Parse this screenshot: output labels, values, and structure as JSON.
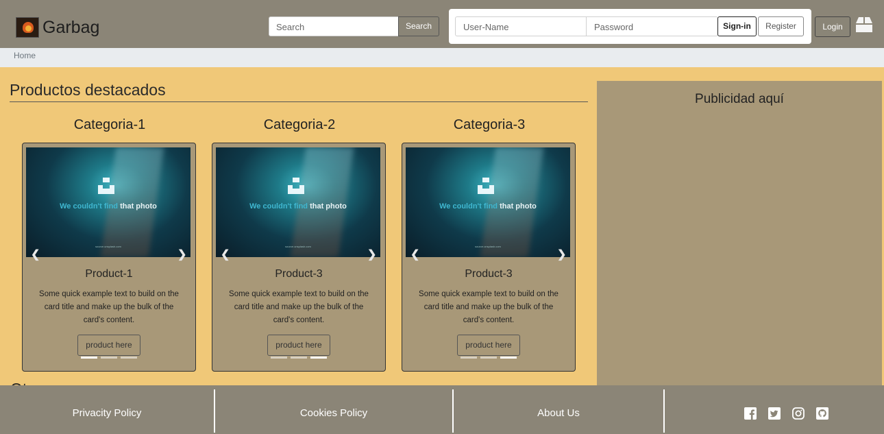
{
  "header": {
    "brand": "Garbag",
    "search_placeholder": "Search",
    "search_button": "Search",
    "username_placeholder": "User-Name",
    "password_placeholder": "Password",
    "signin_button": "Sign-in",
    "register_button": "Register",
    "login_button": "Login"
  },
  "breadcrumb": {
    "home": "Home"
  },
  "main": {
    "section_title": "Productos destacados",
    "categories": [
      {
        "name": "Categoria-1"
      },
      {
        "name": "Categoria-2"
      },
      {
        "name": "Categoria-3"
      }
    ],
    "cards": [
      {
        "title": "Product-1",
        "text": "Some quick example text to build on the card title and make up the bulk of the card's content.",
        "button": "product here",
        "image_text_a": "We couldn't find",
        "image_text_b": " that photo",
        "image_url": "source.unsplash.com",
        "active_slide": 1,
        "slides": 3
      },
      {
        "title": "Product-3",
        "text": "Some quick example text to build on the card title and make up the bulk of the card's content.",
        "button": "product here",
        "image_text_a": "We couldn't find",
        "image_text_b": " that photo",
        "image_url": "source.unsplash.com",
        "active_slide": 3,
        "slides": 3
      },
      {
        "title": "Product-3",
        "text": "Some quick example text to build on the card title and make up the bulk of the card's content.",
        "button": "product here",
        "image_text_a": "We couldn't find",
        "image_text_b": " that photo",
        "image_url": "source.unsplash.com",
        "active_slide": 3,
        "slides": 3
      }
    ],
    "ad_text": "Publicidad aquí",
    "cut_off_heading": "Ot"
  },
  "footer": {
    "links": [
      "Privacity Policy",
      "Cookies Policy",
      "About Us"
    ],
    "social_icons": [
      "facebook-icon",
      "twitter-icon",
      "instagram-icon",
      "github-icon"
    ]
  },
  "colors": {
    "page_background": "#f0c878",
    "navbar": "#8b8577",
    "card": "#a89878",
    "breadcrumb": "#e9ecef"
  }
}
